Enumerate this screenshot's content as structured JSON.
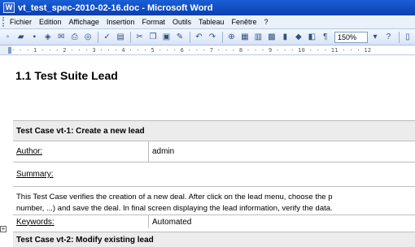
{
  "window": {
    "title": "vt_test_spec-2010-02-16.doc - Microsoft Word",
    "app_icon": "W"
  },
  "menu": [
    "Fichier",
    "Edition",
    "Affichage",
    "Insertion",
    "Format",
    "Outils",
    "Tableau",
    "Fenêtre",
    "?"
  ],
  "toolbar": {
    "zoom": "150%",
    "icons": [
      "new-doc-icon",
      "open-icon",
      "save-icon",
      "permission-icon",
      "email-icon",
      "print-icon",
      "print-preview-icon",
      "spelling-icon",
      "research-icon",
      "cut-icon",
      "copy-icon",
      "paste-icon",
      "format-painter-icon",
      "undo-icon",
      "redo-icon",
      "hyperlink-icon",
      "tables-borders-icon",
      "insert-table-icon",
      "insert-excel-icon",
      "columns-icon",
      "drawing-icon",
      "document-map-icon",
      "show-formatting-icon",
      "zoom-dropdown-icon",
      "help-icon",
      "reading-icon"
    ]
  },
  "ruler": {
    "ticks": "· · · 1 · · · 2 · · · 3 · · · 4 · · · 5 · · · 6 · · · 7 · · · 8 · · · 9 · · · 10 · · · 11 · · · 12"
  },
  "document": {
    "heading": "1.1 Test Suite Lead",
    "test_case_1": {
      "title": "Test Case vt-1: Create a new lead",
      "author_label": "Author:",
      "author_value": "admin",
      "summary_label": "Summary:",
      "summary_text_1": "This Test Case verifies the creation of a new deal. After click on the lead menu, choose the p",
      "summary_text_2": "number, ...) and save the deal. In final screen displaying the lead information, verify the data.",
      "keywords_label": "Keywords:",
      "keywords_value": "Automated"
    },
    "test_case_2": {
      "title": "Test Case vt-2: Modify existing lead"
    }
  },
  "colors": {
    "titlebar": "#0a3fb0",
    "menubar": "#eaf1fb",
    "table_header": "#ececec"
  }
}
